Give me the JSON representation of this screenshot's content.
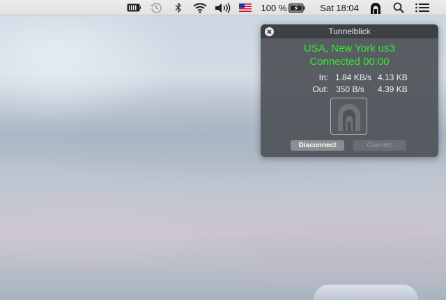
{
  "menubar": {
    "icons": [
      "battery-status-icon",
      "time-machine-icon",
      "bluetooth-icon",
      "wifi-icon",
      "volume-icon",
      "us-flag-icon",
      "battery-charging-icon",
      "tunnelblick-icon",
      "spotlight-search-icon",
      "notification-center-icon"
    ],
    "battery_percent": "100 %",
    "clock": "Sat 18:04"
  },
  "hud": {
    "title": "Tunnelblick",
    "connection_name": "USA, New York us3",
    "connection_status": "Connected 00:00",
    "stats": {
      "in_label": "In:",
      "in_rate": "1.84 KB/s",
      "in_total": "4.13 KB",
      "out_label": "Out:",
      "out_rate": "350 B/s",
      "out_total": "4.39 KB"
    },
    "disconnect_label": "Disconnect",
    "connect_label": "Connect",
    "status_color": "#35e635"
  }
}
